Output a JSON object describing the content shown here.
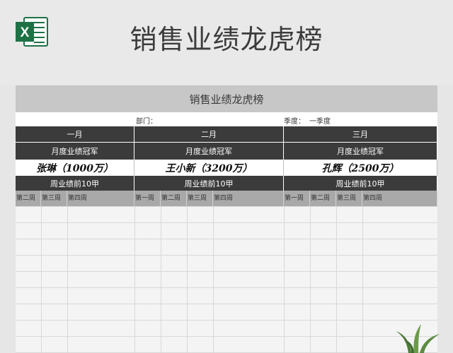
{
  "header": {
    "app_icon": "excel-icon",
    "title": "销售业绩龙虎榜"
  },
  "sheet": {
    "title": "销售业绩龙虎榜",
    "dept_label": "部门：",
    "quarter_label": "季度：",
    "quarter_value": "一季度",
    "months": [
      "一月",
      "二月",
      "三月"
    ],
    "month_champion_label": "月度业绩冠军",
    "champions": [
      "张琳（1000万）",
      "王小新（3200万）",
      "孔辉（2500万）"
    ],
    "top10_label": "周业绩前10甲",
    "week_headers": [
      "第二周",
      "第三周",
      "第四周",
      "第一周",
      "第二周",
      "第三周",
      "第四周",
      "第一周",
      "第二周",
      "第三周",
      "第四周"
    ]
  },
  "colors": {
    "dark_header": "#3b3b3b",
    "title_bar": "#c7c7c7",
    "excel_green": "#1e7145"
  },
  "decoration": {
    "plant": "plant-icon"
  }
}
